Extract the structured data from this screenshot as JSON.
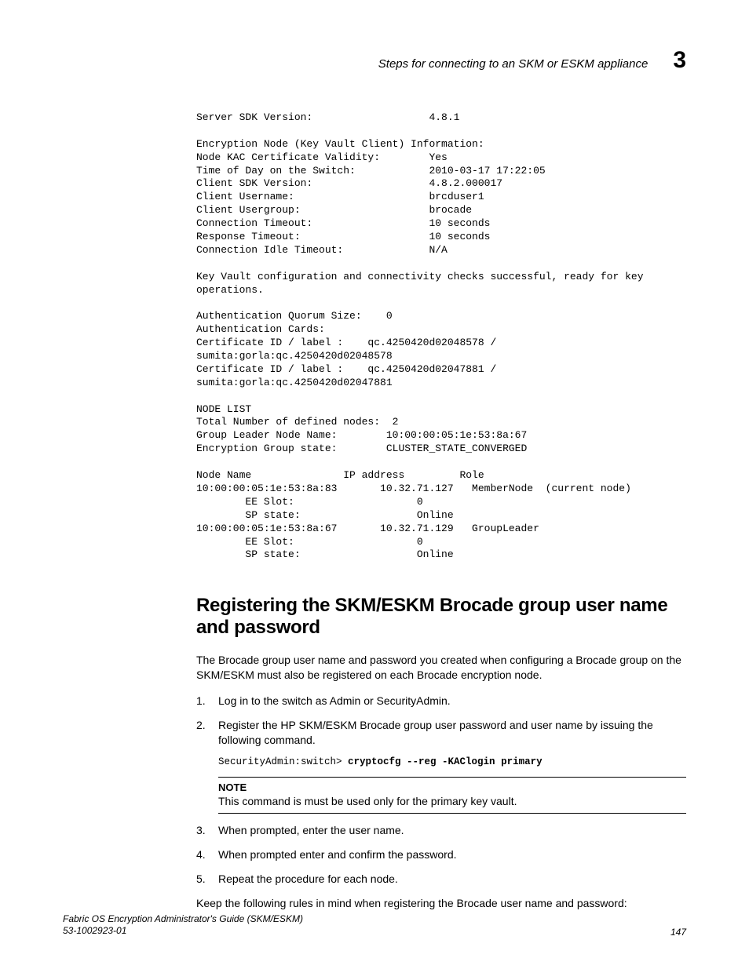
{
  "header": {
    "title": "Steps for connecting to an SKM or ESKM appliance",
    "chapter": "3"
  },
  "mono": "Server SDK Version:                   4.8.1\n\nEncryption Node (Key Vault Client) Information:\nNode KAC Certificate Validity:        Yes\nTime of Day on the Switch:            2010-03-17 17:22:05\nClient SDK Version:                   4.8.2.000017\nClient Username:                      brcduser1\nClient Usergroup:                     brocade\nConnection Timeout:                   10 seconds\nResponse Timeout:                     10 seconds\nConnection Idle Timeout:              N/A\n\nKey Vault configuration and connectivity checks successful, ready for key\noperations.\n\nAuthentication Quorum Size:    0\nAuthentication Cards:\nCertificate ID / label :    qc.4250420d02048578 /\nsumita:gorla:qc.4250420d02048578\nCertificate ID / label :    qc.4250420d02047881 /\nsumita:gorla:qc.4250420d02047881\n\nNODE LIST\nTotal Number of defined nodes:  2\nGroup Leader Node Name:        10:00:00:05:1e:53:8a:67\nEncryption Group state:        CLUSTER_STATE_CONVERGED\n\nNode Name               IP address         Role\n10:00:00:05:1e:53:8a:83       10.32.71.127   MemberNode  (current node)\n        EE Slot:                    0\n        SP state:                   Online\n10:00:00:05:1e:53:8a:67       10.32.71.129   GroupLeader\n        EE Slot:                    0\n        SP state:                   Online",
  "section": {
    "heading": "Registering the SKM/ESKM Brocade group user name and password",
    "intro": "The Brocade group user name and password you created when configuring a Brocade group on the SKM/ESKM must also be registered on each Brocade encryption node.",
    "steps": {
      "s1": "Log in to the switch as Admin or SecurityAdmin.",
      "s2": "Register the HP SKM/ESKM Brocade group user password and user name by issuing the following command.",
      "s2_cmd_prefix": "SecurityAdmin:switch> ",
      "s2_cmd_bold": "cryptocfg --reg -KAClogin primary",
      "s2_note_label": "NOTE",
      "s2_note_text": "This command is must be used only for the primary key vault.",
      "s3": "When prompted, enter the user name.",
      "s4": "When prompted enter and confirm the password.",
      "s5": "Repeat the procedure for each node."
    },
    "outro": "Keep the following rules in mind when registering the Brocade user name and password:"
  },
  "footer": {
    "line1": "Fabric OS Encryption Administrator's Guide (SKM/ESKM)",
    "line2": "53-1002923-01",
    "page": "147"
  }
}
